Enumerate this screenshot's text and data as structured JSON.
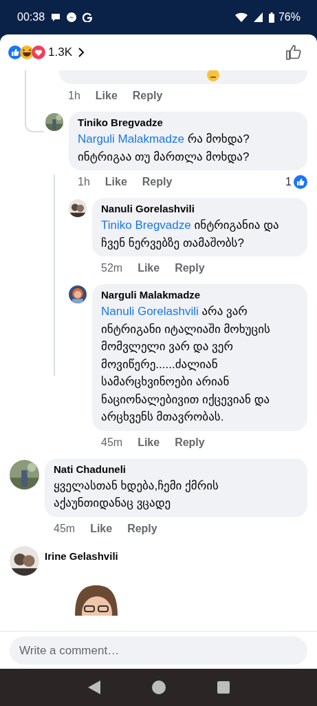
{
  "status_bar": {
    "time": "00:38",
    "battery": "76%"
  },
  "reactions": {
    "count": "1.3K"
  },
  "comments": [
    {
      "kind": "cut",
      "time": "1h",
      "like": "Like",
      "reply": "Reply",
      "children": [
        {
          "kind": "text",
          "author": "Tiniko Bregvadze",
          "mention": "Narguli Malakmadze",
          "text": "რა მოხდა? ინტრიგაა თუ მართლა მოხდა?",
          "time": "1h",
          "like": "Like",
          "reply": "Reply",
          "reaction_count": "1",
          "children": [
            {
              "kind": "text",
              "author": "Nanuli Gorelashvili",
              "mention": "Tiniko Bregvadze",
              "text": "ინტრიგანია და ჩვენ ნერვებზე თამაშობს?",
              "time": "52m",
              "like": "Like",
              "reply": "Reply"
            },
            {
              "kind": "text",
              "author": "Narguli Malakmadze",
              "mention": "Nanuli Gorelashvili",
              "text": "არა ვარ ინტრიგანი იტალიაში მოხუცის მომვლელი ვარ და ვერ მოვიწერე......ძალიან სამარცხვინოები არიან ნაციონალებივით იქცევიან და არცხვენს მთავრობას.",
              "time": "45m",
              "like": "Like",
              "reply": "Reply"
            }
          ]
        }
      ]
    },
    {
      "kind": "text",
      "author": "Nati Chaduneli",
      "text": "ყველასთან ხდება,ჩემი ქმრის აქაუნთიდანაც ვცადე",
      "time": "45m",
      "like": "Like",
      "reply": "Reply"
    },
    {
      "kind": "sticker",
      "author": "Irine Gelashvili"
    }
  ],
  "composer": {
    "placeholder": "Write a comment…"
  }
}
